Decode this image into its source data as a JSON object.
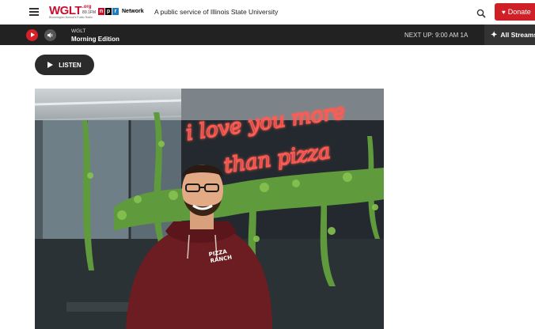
{
  "header": {
    "logo_main": "WGLT",
    "logo_org": ".org",
    "logo_freq": "89.1FM",
    "logo_tag": "Bloomington-Normal's Public Radio",
    "npr_letters": [
      "n",
      "p",
      "r"
    ],
    "npr_network": "Network",
    "tagline": "A public service of Illinois State University",
    "donate_label": "Donate"
  },
  "player": {
    "station": "WGLT",
    "program": "Morning Edition",
    "next_up": "NEXT UP: 9:00 AM 1A",
    "all_streams": "All Streams"
  },
  "article": {
    "listen_label": "LISTEN"
  },
  "photo": {
    "neon_line1": "i love you more",
    "neon_line2": "than pizza",
    "hoodie_logo_line1": "PIZZA",
    "hoodie_logo_line2": "RANCH"
  },
  "colors": {
    "brand_red": "#c8102e",
    "donate_red": "#cf1f27",
    "player_bg": "#222222",
    "neon": "#ff5b52"
  },
  "icons": {
    "menu": "hamburger-icon",
    "search": "search-icon",
    "heart": "heart-icon",
    "play": "play-icon",
    "volume": "volume-icon",
    "streams": "sparkle-icon"
  }
}
